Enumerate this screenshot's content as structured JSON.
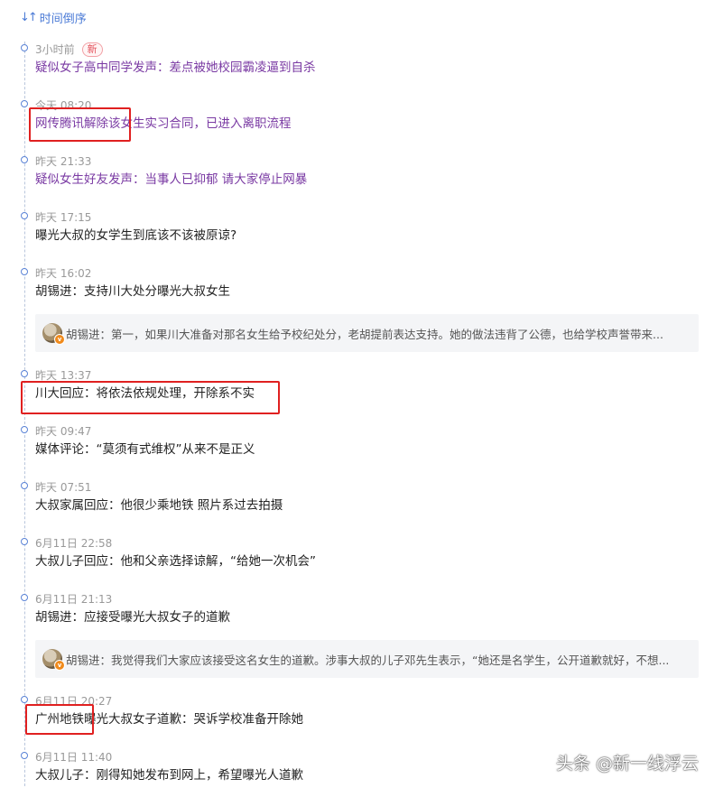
{
  "sort": {
    "icon": "sort-arrows-icon",
    "label": "时间倒序"
  },
  "colors": {
    "link": "#4a7ad6",
    "visited": "#7a3aa3",
    "highlight": "#e02020",
    "new_badge": "#e4525c"
  },
  "items": [
    {
      "time": "3小时前",
      "badge": "新",
      "title": "疑似女子高中同学发声：差点被她校园霸凌逼到自杀",
      "visited": true
    },
    {
      "time": "今天 08:20",
      "title": "网传腾讯解除该女生实习合同，已进入离职流程",
      "visited": true
    },
    {
      "time": "昨天 21:33",
      "title": "疑似女生好友发声：当事人已抑郁 请大家停止网暴",
      "visited": true
    },
    {
      "time": "昨天 17:15",
      "title": "曝光大叔的女学生到底该不该被原谅?",
      "visited": false
    },
    {
      "time": "昨天 16:02",
      "title": "胡锡进：支持川大处分曝光大叔女生",
      "visited": false,
      "quote": "胡锡进：第一，如果川大准备对那名女生给予校纪处分，老胡提前表达支持。她的做法违背了公德，也给学校声誉带来..."
    },
    {
      "time": "昨天 13:37",
      "title": "川大回应：将依法依规处理，开除系不实",
      "visited": false
    },
    {
      "time": "昨天 09:47",
      "title": "媒体评论：“莫须有式维权”从来不是正义",
      "visited": false
    },
    {
      "time": "昨天 07:51",
      "title": "大叔家属回应：他很少乘地铁 照片系过去拍摄",
      "visited": false
    },
    {
      "time": "6月11日 22:58",
      "title": "大叔儿子回应：他和父亲选择谅解，“给她一次机会”",
      "visited": false
    },
    {
      "time": "6月11日 21:13",
      "title": "胡锡进：应接受曝光大叔女子的道歉",
      "visited": false,
      "quote": "胡锡进：我觉得我们大家应该接受这名女生的道歉。涉事大叔的儿子邓先生表示，“她还是名学生，公开道歉就好，不想..."
    },
    {
      "time": "6月11日 20:27",
      "title": "广州地铁曝光大叔女子道歉：哭诉学校准备开除她",
      "visited": false
    },
    {
      "time": "6月11日 11:40",
      "title": "大叔儿子：刚得知她发布到网上，希望曝光人道歉",
      "visited": false
    }
  ],
  "watermark": "头条 @新一线浮云"
}
